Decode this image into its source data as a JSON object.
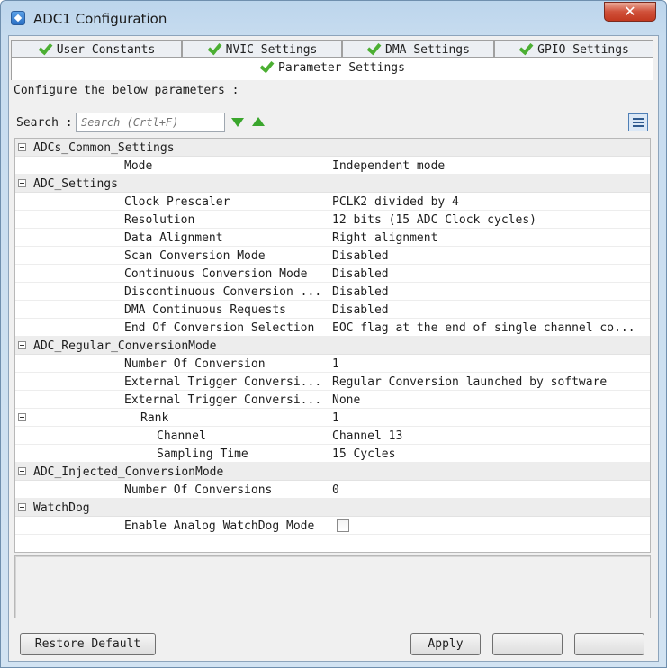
{
  "window": {
    "title": "ADC1 Configuration"
  },
  "tabs": [
    {
      "label": "User Constants",
      "status": "ok"
    },
    {
      "label": "NVIC Settings",
      "status": "ok"
    },
    {
      "label": "DMA Settings",
      "status": "ok"
    },
    {
      "label": "GPIO Settings",
      "status": "ok"
    }
  ],
  "active_tab": {
    "label": "Parameter Settings",
    "status": "ok"
  },
  "header": {
    "configure_text": "Configure the below parameters :"
  },
  "search": {
    "label": "Search :",
    "placeholder": "Search (Crtl+F)"
  },
  "parameters": {
    "g1": {
      "label": "ADCs_Common_Settings"
    },
    "r1": {
      "label": "Mode",
      "value": "Independent mode"
    },
    "g2": {
      "label": "ADC_Settings"
    },
    "r2": {
      "label": "Clock Prescaler",
      "value": "PCLK2 divided by 4"
    },
    "r3": {
      "label": "Resolution",
      "value": "12 bits (15 ADC Clock cycles)"
    },
    "r4": {
      "label": "Data Alignment",
      "value": "Right alignment"
    },
    "r5": {
      "label": "Scan Conversion Mode",
      "value": "Disabled"
    },
    "r6": {
      "label": "Continuous Conversion Mode",
      "value": "Disabled"
    },
    "r7": {
      "label": "Discontinuous Conversion ...",
      "value": "Disabled"
    },
    "r8": {
      "label": "DMA Continuous Requests",
      "value": "Disabled"
    },
    "r9": {
      "label": "End Of Conversion Selection",
      "value": "EOC flag at the end of single channel co..."
    },
    "g3": {
      "label": "ADC_Regular_ConversionMode"
    },
    "r10": {
      "label": "Number Of Conversion",
      "value": "1"
    },
    "r11": {
      "label": "External Trigger Conversi...",
      "value": "Regular Conversion launched by software"
    },
    "r12": {
      "label": "External Trigger Conversi...",
      "value": "None"
    },
    "r13": {
      "label": "Rank",
      "value": "1"
    },
    "r14": {
      "label": "Channel",
      "value": "Channel 13"
    },
    "r15": {
      "label": "Sampling Time",
      "value": "15 Cycles"
    },
    "g4": {
      "label": "ADC_Injected_ConversionMode"
    },
    "r16": {
      "label": "Number Of Conversions",
      "value": "0"
    },
    "g5": {
      "label": "WatchDog"
    },
    "r17": {
      "label": "Enable Analog WatchDog Mode",
      "checked": false
    }
  },
  "buttons": {
    "restore_default": "Restore Default",
    "apply": "Apply"
  },
  "colors": {
    "ok_check": "#4caf33",
    "close_button": "#c9442c",
    "group_row_bg": "#ededed"
  },
  "icons": {
    "tab_status": "check-icon",
    "search_next": "arrow-down-icon",
    "search_prev": "arrow-up-icon",
    "list_toggle": "list-view-icon",
    "group_toggle": "collapse-icon"
  }
}
